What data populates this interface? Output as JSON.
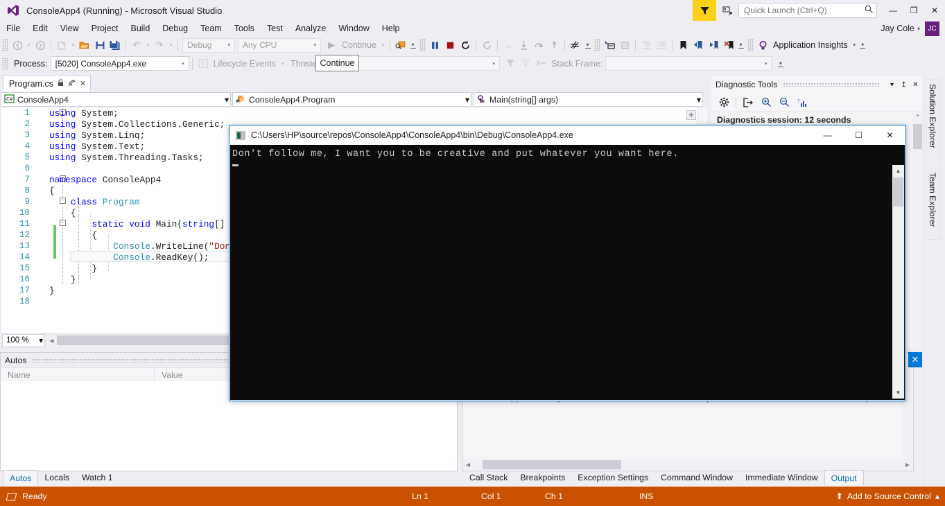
{
  "window": {
    "title": "ConsoleApp4 (Running) - Microsoft Visual Studio",
    "minimize": "—",
    "restore": "❐",
    "close": "✕"
  },
  "menu": {
    "items": [
      "File",
      "Edit",
      "View",
      "Project",
      "Build",
      "Debug",
      "Team",
      "Tools",
      "Test",
      "Analyze",
      "Window",
      "Help"
    ],
    "user": "Jay Cole",
    "user_caret": "▾",
    "avatar_initials": "JC"
  },
  "quick_launch": {
    "placeholder": "Quick Launch (Ctrl+Q)",
    "value": "",
    "icon": "search-icon"
  },
  "toolbar1": {
    "navigate_back": "◀",
    "navigate_forward": "▶",
    "new_project": "new-project-icon",
    "open_file": "open-file-icon",
    "save": "save-icon",
    "save_all": "save-all-icon",
    "undo": "↶",
    "redo": "↷",
    "config": "Debug",
    "platform": "Any CPU",
    "continue": "Continue",
    "continue_tooltip": "Continue",
    "attach": "attach-icon",
    "pause": "pause-icon",
    "stop": "stop-icon",
    "restart": "restart-icon",
    "refresh": "refresh-icon",
    "show_next": "→",
    "step_into": "step-into-icon",
    "step_over": "step-over-icon",
    "step_out": "step-out-icon",
    "hot_reload": "hot-reload-icon",
    "comment": "comment-icon",
    "uncomment": "uncomment-icon",
    "indent": "indent-icon",
    "outdent": "outdent-icon",
    "bookmark": "bookmark-icon",
    "prev_bookmark": "prev-bookmark-icon",
    "next_bookmark": "next-bookmark-icon",
    "clear_bookmarks": "clear-bookmarks-icon",
    "app_insights": "Application Insights"
  },
  "toolbar2": {
    "process_label": "Process:",
    "process_value": "[5020] ConsoleApp4.exe",
    "lifecycle_events": "Lifecycle Events",
    "thread_label": "Thread:",
    "thread_value": "",
    "stack_frame_label": "Stack Frame:",
    "stack_frame_value": ""
  },
  "document": {
    "tab_name": "Program.cs",
    "pin_icon": "pin-icon",
    "close_icon": "✕",
    "nav_project": "ConsoleApp4",
    "nav_type": "ConsoleApp4.Program",
    "nav_member": "Main(string[] args)",
    "zoom": "100 %"
  },
  "code": {
    "lines": [
      {
        "n": 1,
        "text": "using System;"
      },
      {
        "n": 2,
        "text": "using System.Collections.Generic;"
      },
      {
        "n": 3,
        "text": "using System.Linq;"
      },
      {
        "n": 4,
        "text": "using System.Text;"
      },
      {
        "n": 5,
        "text": "using System.Threading.Tasks;"
      },
      {
        "n": 6,
        "text": ""
      },
      {
        "n": 7,
        "text": "namespace ConsoleApp4"
      },
      {
        "n": 8,
        "text": "{"
      },
      {
        "n": 9,
        "text": "    class Program"
      },
      {
        "n": 10,
        "text": "    {"
      },
      {
        "n": 11,
        "text": "        static void Main(string[] args)"
      },
      {
        "n": 12,
        "text": "        {"
      },
      {
        "n": 13,
        "text": "            Console.WriteLine(\"Don't follow me, I want you to be creative and put whatever you want here.\");"
      },
      {
        "n": 14,
        "text": "            Console.ReadKey();"
      },
      {
        "n": 15,
        "text": "        }"
      },
      {
        "n": 16,
        "text": "    }"
      },
      {
        "n": 17,
        "text": "}"
      },
      {
        "n": 18,
        "text": ""
      }
    ]
  },
  "console": {
    "title": "C:\\Users\\HP\\source\\repos\\ConsoleApp4\\ConsoleApp4\\bin\\Debug\\ConsoleApp4.exe",
    "output": "Don't follow me, I want you to be creative and put whatever you want here.",
    "minimize": "—",
    "maximize": "☐",
    "close": "✕"
  },
  "diagnostics": {
    "title": "Diagnostic Tools",
    "dropdown": "▾",
    "pin": "↥",
    "close": "✕",
    "settings_icon": "gear-icon",
    "export_icon": "export-icon",
    "zoom_in_icon": "zoom-in-icon",
    "zoom_out_icon": "zoom-out-icon",
    "chart_icon": "chart-icon",
    "session": "Diagnostics session: 12 seconds"
  },
  "autos": {
    "title": "Autos",
    "columns": [
      "Name",
      "Value"
    ],
    "rows": [],
    "tabs": [
      {
        "label": "Autos",
        "active": true
      },
      {
        "label": "Locals",
        "active": false
      },
      {
        "label": "Watch 1",
        "active": false
      }
    ]
  },
  "output": {
    "line": "'ConsoleApp4.exe' (CLR v4.0.30319: DefaultDomain): Loaded 'C:\\Users\\HP\\source\\repos\\ConsoleA",
    "tabs": [
      {
        "label": "Call Stack",
        "active": false
      },
      {
        "label": "Breakpoints",
        "active": false
      },
      {
        "label": "Exception Settings",
        "active": false
      },
      {
        "label": "Command Window",
        "active": false
      },
      {
        "label": "Immediate Window",
        "active": false
      },
      {
        "label": "Output",
        "active": true
      }
    ]
  },
  "right_rail": {
    "tabs": [
      "Solution Explorer",
      "Team Explorer"
    ]
  },
  "status": {
    "ready": "Ready",
    "ln": "Ln 1",
    "col": "Col 1",
    "ch": "Ch 1",
    "ins": "INS",
    "source_control": "Add to Source Control",
    "source_control_icon": "⬆",
    "source_control_caret": "▴"
  },
  "colors": {
    "accent_orange": "#ca5100",
    "accent_blue": "#0078d7",
    "feedback_yellow": "#fcd116",
    "avatar_purple": "#68217a",
    "console_bg": "#0c0c0c"
  }
}
